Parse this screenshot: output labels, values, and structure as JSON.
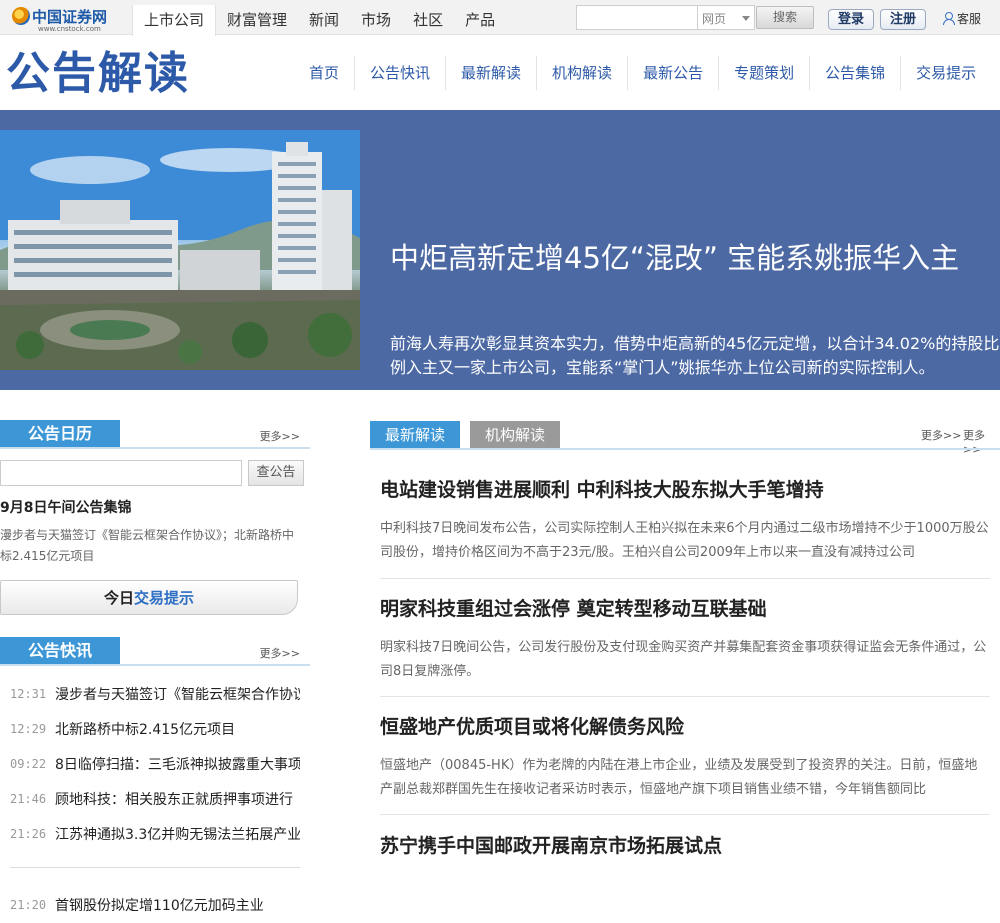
{
  "topbar": {
    "logo_name": "中国证券网",
    "logo_url": "www.cnstock.com",
    "nav": [
      "上市公司",
      "财富管理",
      "新闻",
      "市场",
      "社区",
      "产品"
    ],
    "search_placeholder": "",
    "search_scope": "网页",
    "search_button": "搜索",
    "login": "登录",
    "register": "注册",
    "service": "客服"
  },
  "header": {
    "title": "公告解读",
    "nav": [
      "首页",
      "公告快讯",
      "最新解读",
      "机构解读",
      "最新公告",
      "专题策划",
      "公告集锦",
      "交易提示"
    ]
  },
  "hero": {
    "title": "中炬高新定增45亿“混改” 宝能系姚振华入主",
    "desc": "前海人寿再次彰显其资本实力，借势中炬高新的45亿元定增，以合计34.02%的持股比例入主又一家上市公司，宝能系“掌门人”姚振华亦上位公司新的实际控制人。"
  },
  "calendar": {
    "label": "公告日历",
    "more": "更多>>",
    "button": "查公告",
    "headline": "9月8日午间公告集锦",
    "summary": "漫步者与天猫签订《智能云框架合作协议》；北新路桥中标2.415亿元项目",
    "today_prefix": "今日",
    "today_link": "交易提示"
  },
  "flash": {
    "label": "公告快讯",
    "more": "更多>>",
    "items": [
      {
        "time": "12:31",
        "text": "漫步者与天猫签订《智能云框架合作协议》"
      },
      {
        "time": "12:29",
        "text": "北新路桥中标2.415亿元项目"
      },
      {
        "time": "09:22",
        "text": "8日临停扫描：三毛派神拟披露重大事项"
      },
      {
        "time": "21:46",
        "text": "顾地科技：相关股东正就质押事项进行"
      },
      {
        "time": "21:26",
        "text": "江苏神通拟3.3亿并购无锡法兰拓展产业"
      },
      {
        "time": "21:20",
        "text": "首钢股份拟定增110亿元加码主业"
      }
    ]
  },
  "right": {
    "tab_active": "最新解读",
    "tab_inactive": "机构解读",
    "more1": "更多>>",
    "more2": "更多>>",
    "articles": [
      {
        "title": "电站建设销售进展顺利 中利科技大股东拟大手笔增持",
        "summary": "中利科技7日晚间发布公告，公司实际控制人王柏兴拟在未来6个月内通过二级市场增持不少于1000万股公司股份，增持价格区间为不高于23元/股。王柏兴自公司2009年上市以来一直没有减持过公司"
      },
      {
        "title": "明家科技重组过会涨停 奠定转型移动互联基础",
        "summary": "明家科技7日晚间公告，公司发行股份及支付现金购买资产并募集配套资金事项获得证监会无条件通过，公司8日复牌涨停。"
      },
      {
        "title": "恒盛地产优质项目或将化解债务风险",
        "summary": "恒盛地产（00845-HK）作为老牌的内陆在港上市企业，业绩及发展受到了投资界的关注。日前，恒盛地产副总裁郑群国先生在接收记者采访时表示，恒盛地产旗下项目销售业绩不错，今年销售额同比"
      },
      {
        "title": "苏宁携手中国邮政开展南京市场拓展试点",
        "summary": ""
      }
    ]
  }
}
